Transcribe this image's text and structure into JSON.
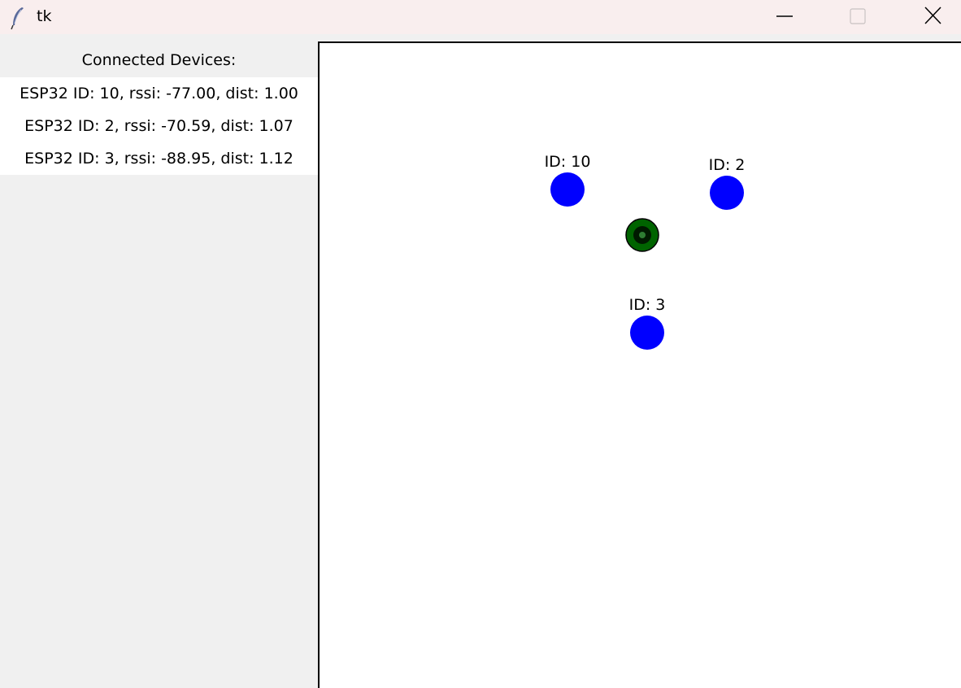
{
  "window": {
    "title": "tk",
    "icon": "feather-icon",
    "controls": [
      "minimize-icon",
      "maximize-icon",
      "close-icon"
    ]
  },
  "sidebar": {
    "header": "Connected Devices:",
    "devices": [
      {
        "text": "ESP32 ID: 10, rssi: -77.00, dist: 1.00"
      },
      {
        "text": "ESP32 ID: 2, rssi: -70.59, dist: 1.07"
      },
      {
        "text": "ESP32 ID: 3, rssi: -88.95, dist: 1.12"
      }
    ]
  },
  "map": {
    "anchors": [
      {
        "label": "ID: 10"
      },
      {
        "label": "ID: 2"
      },
      {
        "label": "ID: 3"
      }
    ],
    "estimated_position_marker": "green-ring-marker",
    "colors": {
      "anchor": "#0000ff",
      "position_marker": "#006400",
      "canvas_background": "#ffffff",
      "sidebar_background": "#f0f0f0"
    }
  }
}
